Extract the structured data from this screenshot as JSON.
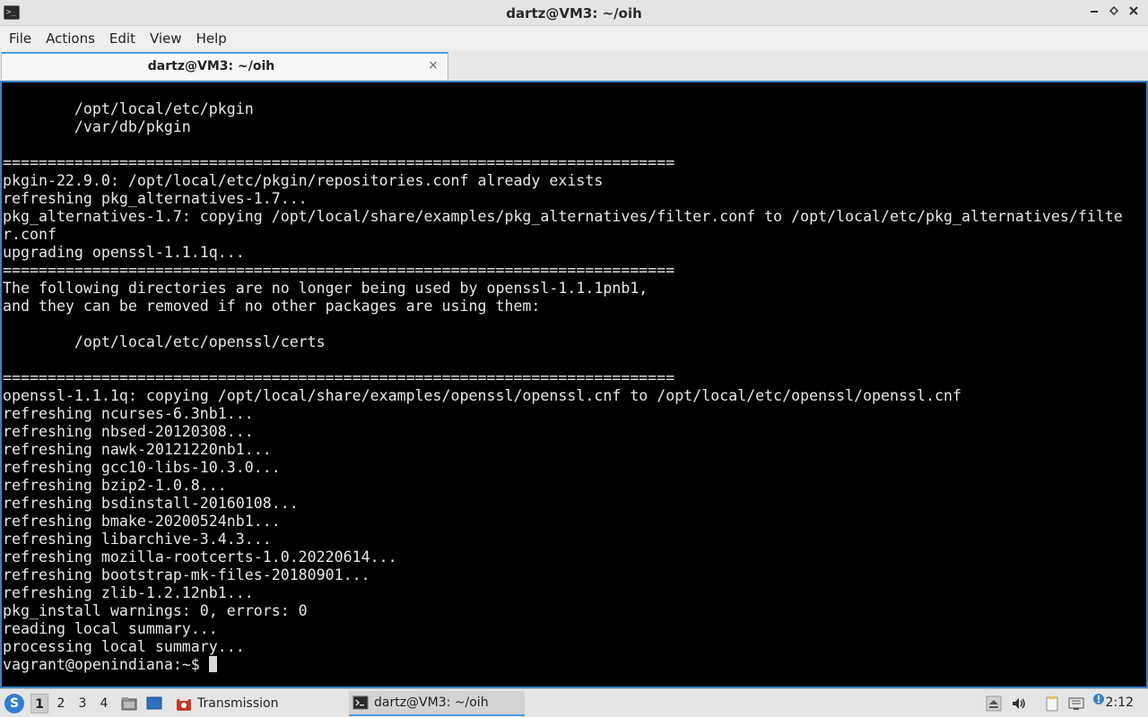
{
  "window": {
    "title": "dartz@VM3: ~/oih",
    "app_icon": ">_",
    "buttons": [
      "minimize-icon",
      "restore-icon",
      "close-icon"
    ]
  },
  "menubar": {
    "items": [
      "File",
      "Actions",
      "Edit",
      "View",
      "Help"
    ]
  },
  "tabs": [
    {
      "label": "dartz@VM3: ~/oih",
      "close": "×"
    }
  ],
  "terminal": {
    "lines": [
      "        /opt/local/etc/pkgin",
      "        /var/db/pkgin",
      "",
      "===========================================================================",
      "pkgin-22.9.0: /opt/local/etc/pkgin/repositories.conf already exists",
      "refreshing pkg_alternatives-1.7...",
      "pkg_alternatives-1.7: copying /opt/local/share/examples/pkg_alternatives/filter.conf to /opt/local/etc/pkg_alternatives/filte",
      "r.conf",
      "upgrading openssl-1.1.1q...",
      "===========================================================================",
      "The following directories are no longer being used by openssl-1.1.1pnb1,",
      "and they can be removed if no other packages are using them:",
      "",
      "        /opt/local/etc/openssl/certs",
      "",
      "===========================================================================",
      "openssl-1.1.1q: copying /opt/local/share/examples/openssl/openssl.cnf to /opt/local/etc/openssl/openssl.cnf",
      "refreshing ncurses-6.3nb1...",
      "refreshing nbsed-20120308...",
      "refreshing nawk-20121220nb1...",
      "refreshing gcc10-libs-10.3.0...",
      "refreshing bzip2-1.0.8...",
      "refreshing bsdinstall-20160108...",
      "refreshing bmake-20200524nb1...",
      "refreshing libarchive-3.4.3...",
      "refreshing mozilla-rootcerts-1.0.20220614...",
      "refreshing bootstrap-mk-files-20180901...",
      "refreshing zlib-1.2.12nb1...",
      "pkg_install warnings: 0, errors: 0",
      "reading local summary...",
      "processing local summary..."
    ],
    "prompt": "vagrant@openindiana:~$ "
  },
  "taskbar": {
    "start_icon": "S",
    "workspaces": [
      "1",
      "2",
      "3",
      "4"
    ],
    "active_workspace": "1",
    "tasks": [
      {
        "label": "Transmission",
        "icon": "transmission-icon"
      },
      {
        "label": "dartz@VM3: ~/oih",
        "icon": "terminal-icon"
      }
    ],
    "clock": "2:12"
  }
}
